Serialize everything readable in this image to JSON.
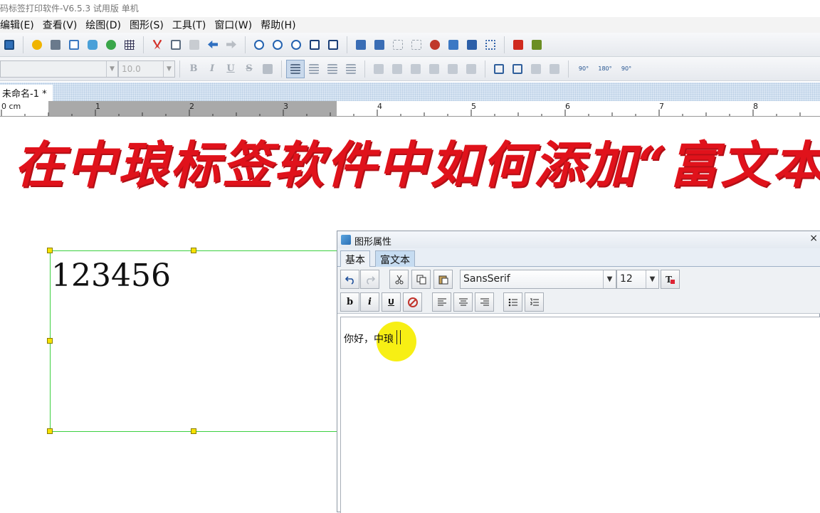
{
  "app": {
    "title": "码标签打印软件-V6.5.3 试用版 单机"
  },
  "menu": [
    "编辑(E)",
    "查看(V)",
    "绘图(D)",
    "图形(S)",
    "工具(T)",
    "窗口(W)",
    "帮助(H)"
  ],
  "toolbar2": {
    "font_value": "",
    "size_value": "10.0",
    "bold": "B",
    "italic": "I",
    "underline": "U",
    "strike": "S",
    "rot90l": "90°",
    "rot180": "180°",
    "rot90r": "90°"
  },
  "document": {
    "tab": "未命名-1 *"
  },
  "ruler": {
    "unit_label": "0 cm",
    "ticks": [
      "1",
      "2",
      "3",
      "4",
      "5",
      "6",
      "7",
      "8"
    ]
  },
  "banner": {
    "text": "在中琅标签软件中如何添加“富文本”"
  },
  "label": {
    "text": "123456"
  },
  "dialog": {
    "title": "图形属性",
    "close": "×",
    "tabs": [
      "基本",
      "富文本"
    ],
    "font": "SansSerif",
    "size": "12",
    "bold": "b",
    "italic": "i",
    "underline": "U",
    "editor_text": "你好，中琅"
  },
  "colors": {
    "banner": "#e0121b",
    "selection": "#3cd040",
    "handle": "#f6e200",
    "cursor_highlight": "#f6ee00"
  }
}
